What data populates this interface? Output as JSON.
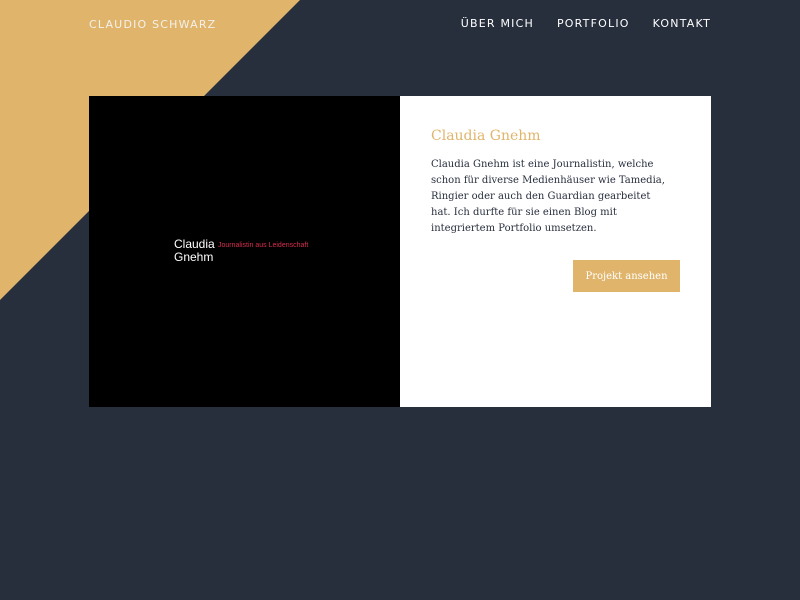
{
  "header": {
    "brand": "CLAUDIO SCHWARZ",
    "nav": [
      {
        "label": "ÜBER MICH"
      },
      {
        "label": "PORTFOLIO"
      },
      {
        "label": "KONTAKT"
      }
    ]
  },
  "project": {
    "logo_name": "Claudia Gnehm",
    "logo_tagline": "Journalistin aus Leidenschaft",
    "title": "Claudia Gnehm",
    "description": "Claudia Gnehm ist eine Journalistin, welche schon für diverse Medienhäuser wie Tamedia, Ringier oder auch den Guardian gearbeitet hat. Ich durfte für sie einen Blog mit integriertem Portfolio umsetzen.",
    "cta_label": "Projekt ansehen"
  },
  "colors": {
    "background": "#272e3c",
    "accent": "#e0b56b",
    "tagline": "#d62e4e"
  }
}
